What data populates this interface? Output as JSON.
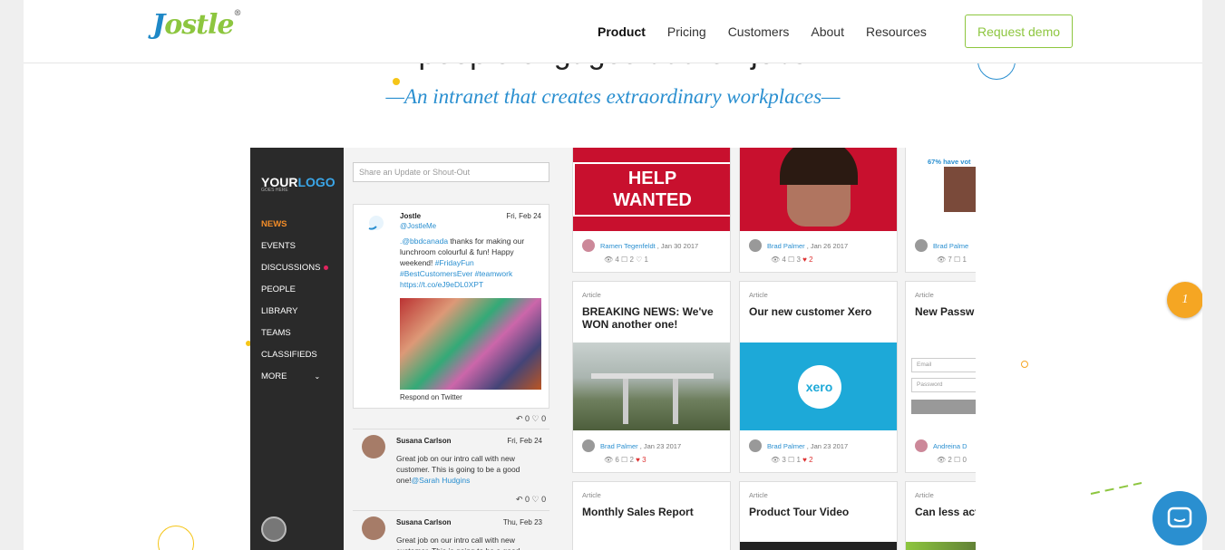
{
  "header": {
    "logo": "Jostle",
    "nav": [
      "Product",
      "Pricing",
      "Customers",
      "About",
      "Resources"
    ],
    "active_nav": "Product",
    "demo_label": "Request demo"
  },
  "hero": {
    "title_fragment": "people engaged at their jobs",
    "tagline": "—An intranet that creates extraordinary workplaces—"
  },
  "app": {
    "brand_your": "YOUR",
    "brand_logo": "LOGO",
    "brand_sub": "GOES HERE",
    "side_items": [
      "NEWS",
      "EVENTS",
      "DISCUSSIONS",
      "PEOPLE",
      "LIBRARY",
      "TEAMS",
      "CLASSIFIEDS",
      "MORE"
    ],
    "share_placeholder": "Share an Update or Shout-Out",
    "tweet": {
      "name": "Jostle",
      "handle": "@JostleMe",
      "date": "Fri, Feb 24",
      "text_a": ".@bbdcanada",
      "text_b": " thanks for making our lunchroom colourful & fun! Happy weekend! ",
      "tags": "#FridayFun #BestCustomersEver #teamwork https://t.co/eJ9eDL0XPT",
      "respond": "Respond on Twitter",
      "actions": "↶ 0 ♡ 0"
    },
    "posts": [
      {
        "name": "Susana Carlson",
        "date": "Fri, Feb 24",
        "text": "Great job on our intro call with new customer. This is going to be a good one!",
        "mention": "@Sarah Hudgins",
        "actions": "↶ 0 ♡ 0"
      },
      {
        "name": "Susana Carlson",
        "date": "Thu, Feb 23",
        "text": "Great job on our intro call with new customer. This is going to be a good",
        "mention": "",
        "actions": ""
      }
    ],
    "cards": [
      {
        "kind": "",
        "title": "",
        "help": "HELP WANTED",
        "author": "Ramen Tegenfeldt",
        "date": ", Jan 30 2017",
        "stats": "👁 4  ☐ 2  ♡ 1"
      },
      {
        "kind": "",
        "title": "",
        "author": "Brad Palmer",
        "date": ", Jan 26 2017",
        "stats": "👁 4  ☐ 3",
        "hearts": "♥ 2"
      },
      {
        "kind": "",
        "title": "",
        "poll": "67% have vot",
        "author": "Brad Palme",
        "date": "",
        "stats": "👁 7  ☐ 1"
      },
      {
        "kind": "Article",
        "title": "BREAKING NEWS: We've WON another one!",
        "author": "Brad Palmer",
        "date": ", Jan 23 2017",
        "stats": "👁 6  ☐ 2",
        "hearts": "♥ 3"
      },
      {
        "kind": "Article",
        "title": "Our new customer Xero",
        "xero": "xero",
        "author": "Brad Palmer",
        "date": ", Jan 23 2017",
        "stats": "👁 3  ☐ 1",
        "hearts": "♥ 2"
      },
      {
        "kind": "Article",
        "title": "New Passw",
        "email": "Email",
        "password": "Password",
        "author": "Andreina D",
        "date": "",
        "stats": "👁 2  ☐ 0"
      },
      {
        "kind": "Article",
        "title": "Monthly Sales Report"
      },
      {
        "kind": "Article",
        "title": "Product Tour Video"
      },
      {
        "kind": "Article",
        "title": "Can less act for an intra"
      }
    ]
  },
  "badge": "1",
  "colors": {
    "brand_green": "#8dc63f",
    "brand_blue": "#2a8fd0",
    "badge_orange": "#f5a623"
  }
}
